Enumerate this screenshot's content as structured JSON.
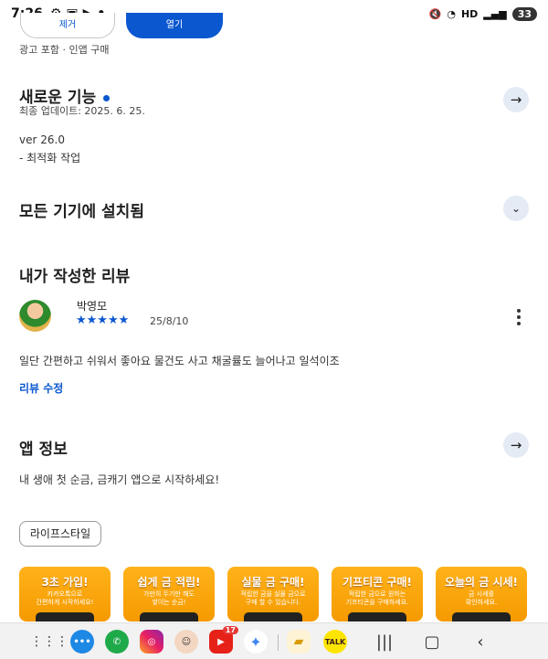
{
  "status": {
    "time": "7:26",
    "battery": "33"
  },
  "top_buttons": {
    "left_label": "제거",
    "right_label": "열기",
    "ad_note": "광고 포함 · 인앱 구매"
  },
  "whats_new": {
    "title": "새로운 기능",
    "updated": "최종 업데이트: 2025. 6. 25.",
    "version": "ver 26.0",
    "note": "- 최적화 작업"
  },
  "installed": {
    "title": "모든 기기에 설치됨"
  },
  "my_review": {
    "title": "내가 작성한 리뷰",
    "reviewer": "박영모",
    "stars": "★★★★★",
    "rating": 5,
    "date": "25/8/10",
    "text": "일단 간편하고 쉬워서 좋아요 물건도 사고 채굴률도 늘어나고 일석이조",
    "edit_label": "리뷰 수정"
  },
  "app_info": {
    "title": "앱 정보",
    "description": "내 생애 첫 순금, 금캐기 앱으로 시작하세요!",
    "category_chip": "라이프스타일"
  },
  "screenshots": [
    {
      "title": "3초 가입!",
      "desc": "카카오톡으로\n간편하게 시작하세요!"
    },
    {
      "title": "쉽게 금 적립!",
      "desc": "가만히 두기만 해도\n쌓이는 순금!"
    },
    {
      "title": "실물 금 구매!",
      "desc": "적립한 금을 실물 금으로\n구매 할 수 있습니다."
    },
    {
      "title": "기프티콘 구매!",
      "desc": "적립한 금으로 원하는\n기프티콘을 구매하세요."
    },
    {
      "title": "오늘의 금 시세!",
      "desc": "금 시세를\n확인하세요."
    }
  ],
  "navbar": {
    "youtube_badge": "17",
    "kakao_label": "TALK"
  },
  "colors": {
    "accent": "#0b57d0",
    "shot_orange": "#f59a00"
  }
}
